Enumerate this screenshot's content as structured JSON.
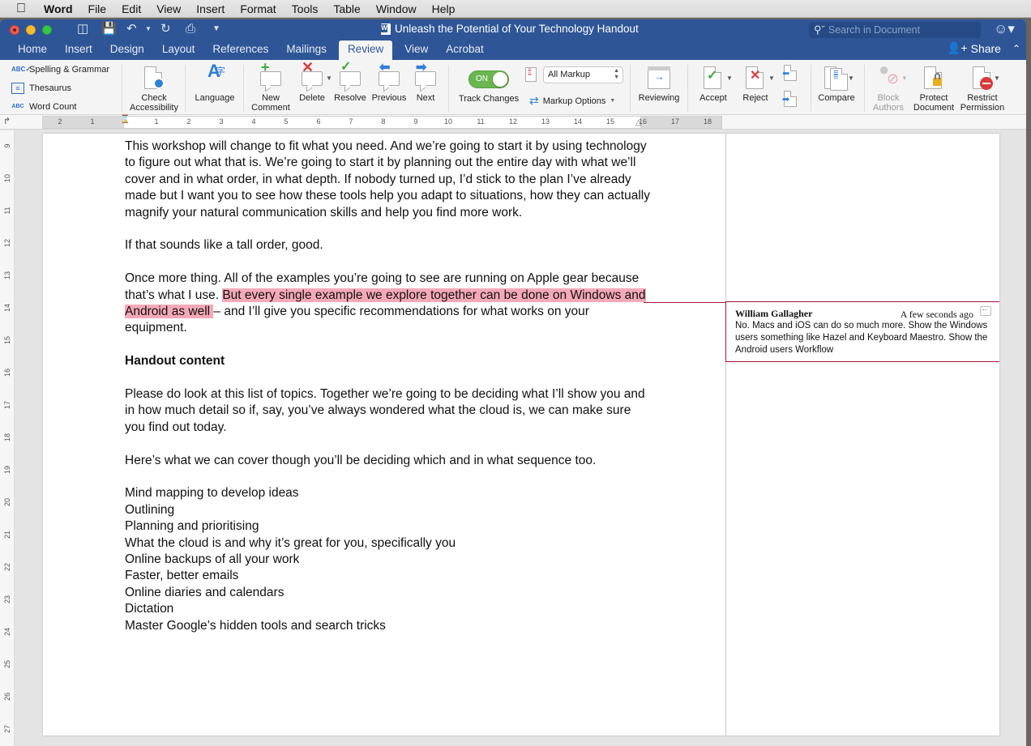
{
  "menubar": {
    "apple": "",
    "items": [
      "Word",
      "File",
      "Edit",
      "View",
      "Insert",
      "Format",
      "Tools",
      "Table",
      "Window",
      "Help"
    ]
  },
  "window": {
    "title": "Unleash the Potential of Your Technology Handout",
    "search_placeholder": "Search in Document",
    "share_label": "Share",
    "tabs": [
      "Home",
      "Insert",
      "Design",
      "Layout",
      "References",
      "Mailings",
      "Review",
      "View",
      "Acrobat"
    ],
    "active_tab": "Review"
  },
  "ribbon": {
    "proofing": {
      "spelling": "Spelling & Grammar",
      "thesaurus": "Thesaurus",
      "word_count": "Word Count"
    },
    "check_accessibility": [
      "Check",
      "Accessibility"
    ],
    "language": "Language",
    "new_comment": [
      "New",
      "Comment"
    ],
    "delete": "Delete",
    "resolve": "Resolve",
    "previous": "Previous",
    "next": "Next",
    "track_changes": {
      "label": "Track Changes",
      "state": "ON"
    },
    "markup_select": "All Markup",
    "markup_options": "Markup Options",
    "reviewing": "Reviewing",
    "accept": "Accept",
    "reject": "Reject",
    "compare": "Compare",
    "block_authors": [
      "Block",
      "Authors"
    ],
    "protect_document": [
      "Protect",
      "Document"
    ],
    "restrict_permission": [
      "Restrict",
      "Permission"
    ]
  },
  "ruler": {
    "h_numbers": [
      "2",
      "1",
      "1",
      "2",
      "3",
      "4",
      "5",
      "6",
      "7",
      "8",
      "9",
      "10",
      "11",
      "12",
      "13",
      "14",
      "15",
      "16",
      "17",
      "18"
    ],
    "v_numbers": [
      "9",
      "10",
      "11",
      "12",
      "13",
      "14",
      "15",
      "16",
      "17",
      "18",
      "19",
      "20",
      "21",
      "22",
      "23",
      "24",
      "25",
      "26",
      "27"
    ]
  },
  "document": {
    "p1": "This workshop will change to fit what you need. And we’re going to start it by using technology to figure out what that is. We’re going to start it by planning out the entire day with what we’ll cover and in what order, in what depth. If nobody turned up, I’d stick to the plan I’ve already made but I want you to see how these tools help you adapt to situations, how they can actually magnify your natural communication skills and help you find more work.",
    "p2": "If that sounds like a tall order, good.",
    "p3_before": "Once more thing. All of the examples you’re going to see are running on Apple gear because that’s what I use. ",
    "p3_highlight": "But every single example we explore together can be done on Windows and Android as well ",
    "p3_after": "– and I’ll give you specific recommendations for what works on your equipment.",
    "heading": "Handout content",
    "p4": "Please do look at this list of topics. Together we’re going to be deciding what I’ll show you and in how much detail so if, say, you’ve always wondered what the cloud is, we can make sure you find out today.",
    "p5": "Here’s what we can cover though you’ll be deciding which and in what sequence too.",
    "topics": [
      "Mind mapping to develop ideas",
      "Outlining",
      "Planning and prioritising",
      "What the cloud is and why it’s great for you, specifically you",
      "Online backups of all your work",
      "Faster, better emails",
      "Online diaries and calendars",
      "Dictation",
      "Master Google’s hidden tools and search tricks"
    ]
  },
  "comment": {
    "author": "William Gallagher",
    "time": "A few seconds ago",
    "text": "No. Macs and iOS can do so much more. Show the Windows users something like Hazel and Keyboard Maestro. Show the Android users Workflow"
  },
  "colors": {
    "titlebar": "#2e5596",
    "highlight": "#f5a9b8",
    "comment_border": "#a5163a",
    "toggle_on": "#6ab751"
  }
}
